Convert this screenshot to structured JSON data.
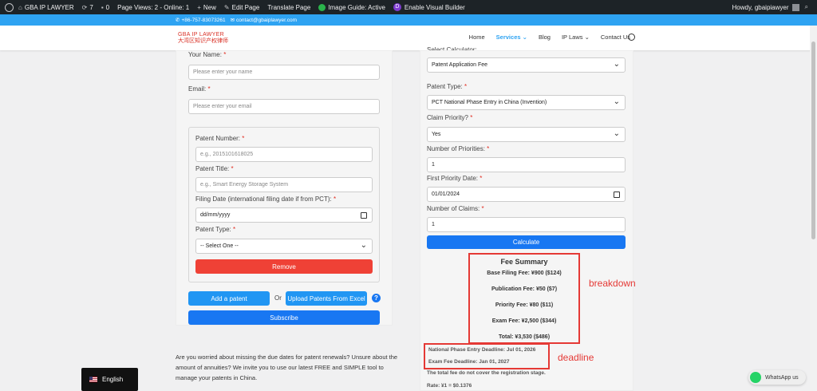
{
  "adminbar": {
    "site_name": "GBA IP LAWYER",
    "updates_count": "7",
    "comments_count": "0",
    "page_views": "Page Views: 2 - Online: 1",
    "new_label": "New",
    "edit_page": "Edit Page",
    "translate_page": "Translate Page",
    "image_guide": "Image Guide: Active",
    "visual_builder": "Enable Visual Builder",
    "howdy": "Howdy, gbaipiawyer"
  },
  "topbar": {
    "phone": "+86-757-83073261",
    "email": "contact@gbaiplawyer.com"
  },
  "header": {
    "logo_line1": "GBA IP LAWYER",
    "logo_line2": "大湾区知识产权律师",
    "nav": [
      "Home",
      "Services",
      "Blog",
      "IP Laws",
      "Contact Us"
    ]
  },
  "left_form": {
    "name_label": "Your Name:",
    "name_placeholder": "Please enter your name",
    "email_label": "Email:",
    "email_placeholder": "Please enter your email",
    "patent_number_label": "Patent Number:",
    "patent_number_placeholder": "e.g., 2015101618025",
    "patent_title_label": "Patent Title:",
    "patent_title_placeholder": "e.g., Smart Energy Storage System",
    "filing_date_label": "Filing Date (international filing date if from PCT):",
    "filing_date_value": "dd/mm/yyyy",
    "patent_type_label": "Patent Type:",
    "patent_type_value": "-- Select One --",
    "remove_button": "Remove",
    "add_button": "Add a patent",
    "or_text": "Or",
    "upload_button": "Upload Patents From Excel",
    "help": "?",
    "subscribe_button": "Subscribe",
    "required_mark": "*"
  },
  "calculator": {
    "select_label": "Select Calculator:",
    "select_value": "Patent Application Fee",
    "patent_type_label": "Patent Type:",
    "patent_type_value": "PCT National Phase Entry in China (Invention)",
    "claim_priority_label": "Claim Priority?",
    "claim_priority_value": "Yes",
    "num_priorities_label": "Number of Priorities:",
    "num_priorities_value": "1",
    "first_priority_label": "First Priority Date:",
    "first_priority_value": "01/01/2024",
    "num_claims_label": "Number of Claims:",
    "num_claims_value": "1",
    "calculate_button": "Calculate",
    "required_mark": "*"
  },
  "fee_summary": {
    "title": "Fee Summary",
    "base": "Base Filing Fee: ¥900 ($124)",
    "publication": "Publication Fee: ¥50 ($7)",
    "priority": "Priority Fee: ¥80 ($11)",
    "exam": "Exam Fee: ¥2,500 ($344)",
    "total": "Total: ¥3,530 ($486)"
  },
  "deadlines": {
    "national_phase": "National Phase Entry Deadline: Jul 01, 2026",
    "exam": "Exam Fee Deadline: Jan 01, 2027",
    "note": "The total fee do not cover the registration stage.",
    "rate": "Rate: ¥1 = $0.1376"
  },
  "annotations": {
    "breakdown": "breakdown",
    "deadline": "deadline"
  },
  "promo_text": "Are you worried about missing the due dates for patent renewals? Unsure about the amount of annuities? We invite you to use our latest FREE and SIMPLE tool to manage your patents in China.",
  "language": "English",
  "whatsapp": "WhatsApp us",
  "colors": {
    "accent": "#2ea3f2",
    "red": "#ef4136",
    "blue": "#1877f2",
    "admin_bg": "#1d2327"
  }
}
